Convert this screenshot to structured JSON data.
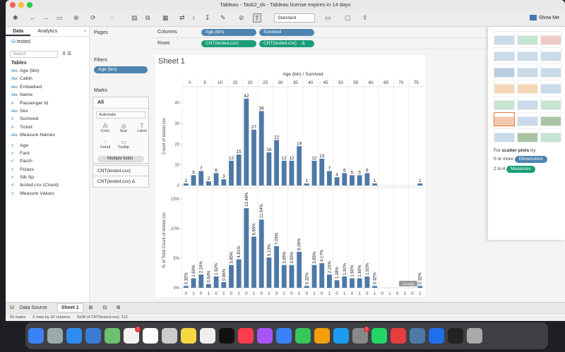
{
  "window_title": "Tableau - Task2_ds - Tableau license expires in 14 days",
  "toolbar": {
    "fit_select": "Standard",
    "show_me": "Show Me"
  },
  "data_pane": {
    "tabs": [
      "Data",
      "Analytics"
    ],
    "datasource": "tested",
    "search_placeholder": "Search",
    "tables_label": "Tables",
    "dimensions": [
      {
        "icon": "Abc",
        "name": "Age (bin)"
      },
      {
        "icon": "Abc",
        "name": "Cabin"
      },
      {
        "icon": "Abc",
        "name": "Embarked"
      },
      {
        "icon": "Abc",
        "name": "Name"
      },
      {
        "icon": "#",
        "name": "Passenger Id"
      },
      {
        "icon": "Abc",
        "name": "Sex"
      },
      {
        "icon": "#",
        "name": "Survived"
      },
      {
        "icon": "#",
        "name": "Ticket"
      },
      {
        "icon": "Abc",
        "name": "Measure Names"
      }
    ],
    "measures": [
      {
        "icon": "#",
        "name": "Age"
      },
      {
        "icon": "#",
        "name": "Fare"
      },
      {
        "icon": "#",
        "name": "Parch"
      },
      {
        "icon": "#",
        "name": "Pclass"
      },
      {
        "icon": "#",
        "name": "Sib Sp"
      },
      {
        "icon": "#",
        "name": "tested.csv (Count)"
      },
      {
        "icon": "#",
        "name": "Measure Values"
      }
    ]
  },
  "cards": {
    "pages": "Pages",
    "filters": "Filters",
    "filter_pill": "Age (bin)",
    "marks": "Marks",
    "all": "All",
    "mark_type": "Automatic",
    "mark_buttons": [
      "Color",
      "Size",
      "Label",
      "Detail",
      "Tooltip"
    ],
    "multiple_fields": "Multiple fields",
    "mark_rows": [
      "CNT(tested.csv)",
      "CNT(tested.csv)"
    ]
  },
  "shelves": {
    "columns_label": "Columns",
    "columns": [
      "Age (bin)",
      "Survived"
    ],
    "rows_label": "Rows",
    "rows": [
      "CNT(tested.csv)",
      "CNT(tested.csv)"
    ],
    "delta": "Δ"
  },
  "sheet": {
    "title": "Sheet 1",
    "header": "Age (bin) / Survived"
  },
  "show_me": {
    "hint_prefix": "For",
    "hint_bold": "scatter plots",
    "hint_suffix": "try",
    "dims_text": "0 or more",
    "dims_pill": "Dimensions",
    "meas_text": "2 to 4",
    "meas_pill": "Measures"
  },
  "sheet_tabs": [
    "Data Source",
    "Sheet 1"
  ],
  "status_bar": [
    "56 marks",
    "2 rows by 32 columns",
    "SUM of CNT(tested.csv): 312"
  ],
  "colors": {
    "bar": "#4e79a7",
    "accent_blue": "#4e84b0",
    "accent_green": "#1a9d78"
  },
  "chart_data": [
    {
      "type": "bar",
      "ylabel": "Count of tested.csv",
      "categories_age": [
        "0",
        "5",
        "10",
        "15",
        "20",
        "25",
        "30",
        "35",
        "40",
        "45",
        "50",
        "55",
        "60",
        "65",
        "70",
        "75"
      ],
      "categories_survived": [
        "0",
        "1"
      ],
      "values": [
        1,
        5,
        7,
        2,
        6,
        3,
        12,
        15,
        42,
        27,
        36,
        16,
        22,
        12,
        12,
        19,
        1,
        12,
        13,
        7,
        4,
        6,
        5,
        5,
        6,
        1,
        0,
        0,
        0,
        0,
        0,
        1
      ],
      "data_labels": [
        "1",
        "5",
        "7",
        "2",
        "6",
        "3",
        "12",
        "15",
        "42",
        "27",
        "36",
        "16",
        "22",
        "12",
        "12",
        "19",
        "1",
        "12",
        "13",
        "7",
        "4",
        "6",
        "5",
        "5",
        "6",
        "1",
        "",
        "",
        "",
        "",
        "",
        "1"
      ],
      "yticks": [
        0,
        10,
        20,
        30,
        40
      ],
      "ylim": [
        0,
        45
      ]
    },
    {
      "type": "bar",
      "ylabel": "% of Total Count of tested.csv",
      "values": [
        0.32,
        1.6,
        2.24,
        0.64,
        1.92,
        0.96,
        3.85,
        4.81,
        13.46,
        8.65,
        11.54,
        5.13,
        7.05,
        3.85,
        3.85,
        6.09,
        0.32,
        3.85,
        4.17,
        2.24,
        1.28,
        1.92,
        1.6,
        1.6,
        1.92,
        0.32,
        0,
        0,
        0,
        0,
        0,
        0.32
      ],
      "data_labels": [
        "0.32%",
        "1.60%",
        "2.24%",
        "0.64%",
        "1.92%",
        "0.96%",
        "3.85%",
        "4.81%",
        "13.46%",
        "8.65%",
        "11.54%",
        "5.13%",
        "7.05%",
        "3.85%",
        "3.85%",
        "6.09%",
        "0.32%",
        "3.85%",
        "4.17%",
        "2.24%",
        "1.28%",
        "1.92%",
        "1.60%",
        "1.60%",
        "1.92%",
        "0.32%",
        "",
        "",
        "",
        "",
        "",
        "0.32%"
      ],
      "yticks": [
        "0%",
        "5%",
        "10%",
        "15%"
      ],
      "ylim": [
        0,
        15.5
      ],
      "null_badge": ">4 nulls"
    }
  ]
}
